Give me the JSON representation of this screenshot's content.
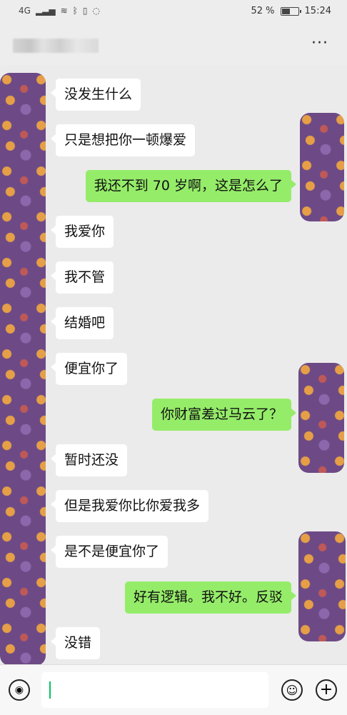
{
  "status_bar": {
    "network": "4G",
    "battery_percent": "52 %",
    "battery_level": 0.52,
    "time": "15:24"
  },
  "header": {
    "more_icon": "more-icon",
    "more_label": "···"
  },
  "messages": [
    {
      "side": "in",
      "text": "没发生什么"
    },
    {
      "side": "in",
      "text": "只是想把你一顿爆爱"
    },
    {
      "side": "out",
      "text": "我还不到 70 岁啊，这是怎么了"
    },
    {
      "side": "in",
      "text": "我爱你"
    },
    {
      "side": "in",
      "text": "我不管"
    },
    {
      "side": "in",
      "text": "结婚吧"
    },
    {
      "side": "in",
      "text": "便宜你了"
    },
    {
      "side": "out",
      "text": "你财富差过马云了？"
    },
    {
      "side": "in",
      "text": "暂时还没"
    },
    {
      "side": "in",
      "text": "但是我爱你比你爱我多"
    },
    {
      "side": "in",
      "text": "是不是便宜你了"
    },
    {
      "side": "out",
      "text": "好有逻辑。我不好。反驳"
    },
    {
      "side": "in",
      "text": "没错"
    }
  ],
  "input_bar": {
    "voice_icon": "voice-icon",
    "voice_glyph": "◉",
    "emoji_icon": "emoji-icon",
    "emoji_glyph": "☺",
    "plus_icon": "plus-icon",
    "plus_glyph": "+",
    "input_value": ""
  },
  "colors": {
    "incoming_bubble": "#ffffff",
    "outgoing_bubble": "#95ec69",
    "chat_background": "#ebebeb",
    "avatar_purple": "#6d4a86"
  }
}
